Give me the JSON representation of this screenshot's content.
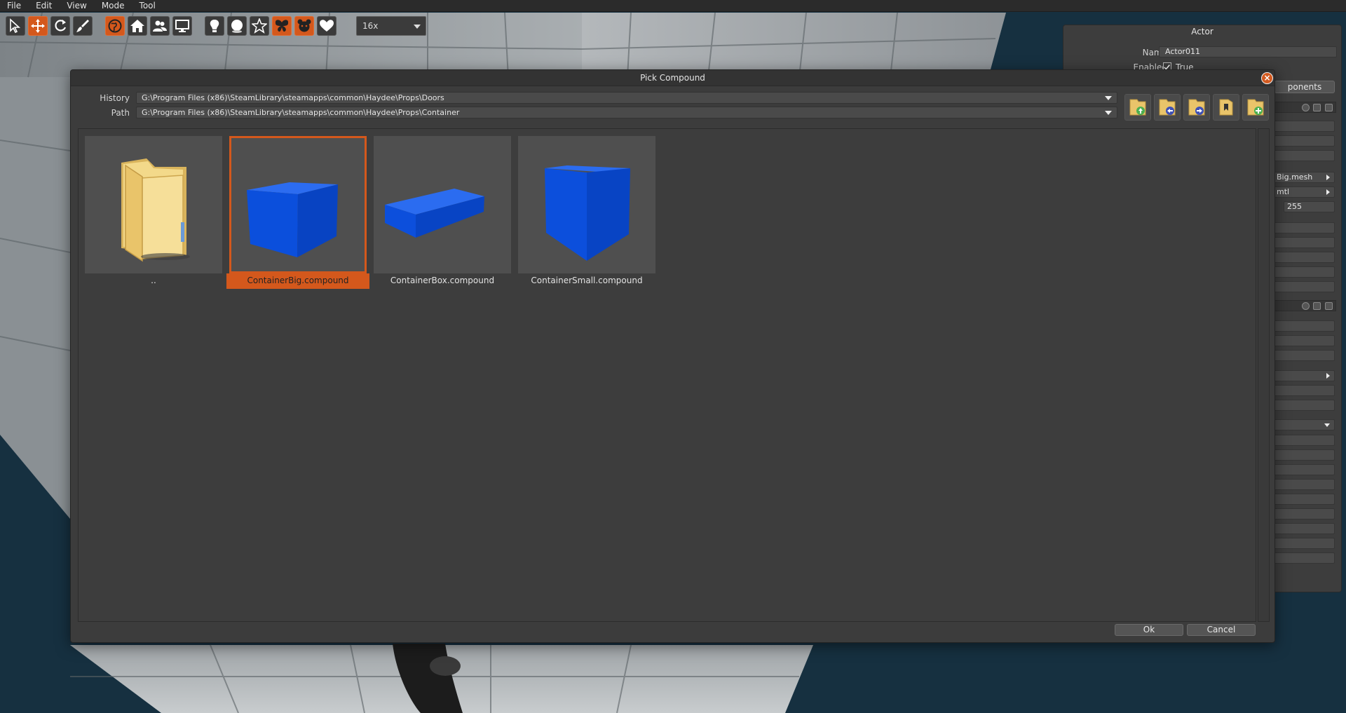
{
  "menubar": {
    "items": [
      "File",
      "Edit",
      "View",
      "Mode",
      "Tool"
    ]
  },
  "toolbar": {
    "tools": [
      {
        "icon": "select-arrow-icon",
        "active": false
      },
      {
        "icon": "move-arrows-icon",
        "active": true
      },
      {
        "icon": "rotate-icon",
        "active": false
      },
      {
        "icon": "paint-brush-icon",
        "active": false
      }
    ],
    "views": [
      {
        "icon": "globe-icon",
        "active": true
      },
      {
        "icon": "house-icon",
        "active": false
      },
      {
        "icon": "users-icon",
        "active": false
      },
      {
        "icon": "monitor-icon",
        "active": false
      }
    ],
    "filters": [
      {
        "icon": "lightbulb-icon",
        "active": false
      },
      {
        "icon": "sphere-icon",
        "active": false
      },
      {
        "icon": "star-icon",
        "active": false
      },
      {
        "icon": "butterfly-icon",
        "active": true
      },
      {
        "icon": "bear-icon",
        "active": true
      },
      {
        "icon": "heart-icon",
        "active": false
      }
    ],
    "zoom": "16x"
  },
  "actor_panel": {
    "title": "Actor",
    "name_label": "Name",
    "name_value": "Actor011",
    "enabled_label": "Enabled",
    "enabled_value": "True",
    "components_label": "ponents",
    "mesh_value": "Big.mesh",
    "material_value": "mtl",
    "color_value": "255"
  },
  "dialog": {
    "title": "Pick Compound",
    "history_label": "History",
    "history_value": "G:\\Program Files (x86)\\SteamLibrary\\steamapps\\common\\Haydee\\Props\\Doors",
    "path_label": "Path",
    "path_value": "G:\\Program Files (x86)\\SteamLibrary\\steamapps\\common\\Haydee\\Props\\Container",
    "nav_buttons": [
      "folder-up-icon",
      "folder-back-icon",
      "folder-forward-icon",
      "folder-bookmark-icon",
      "folder-add-icon"
    ],
    "items": [
      {
        "name": "..",
        "kind": "folder"
      },
      {
        "name": "ContainerBig.compound",
        "kind": "box-big",
        "selected": true
      },
      {
        "name": "ContainerBox.compound",
        "kind": "box-flat"
      },
      {
        "name": "ContainerSmall.compound",
        "kind": "box-small"
      }
    ],
    "ok_label": "Ok",
    "cancel_label": "Cancel"
  },
  "colors": {
    "accent": "#d4581c",
    "box_blue": "#0a4fd8"
  }
}
